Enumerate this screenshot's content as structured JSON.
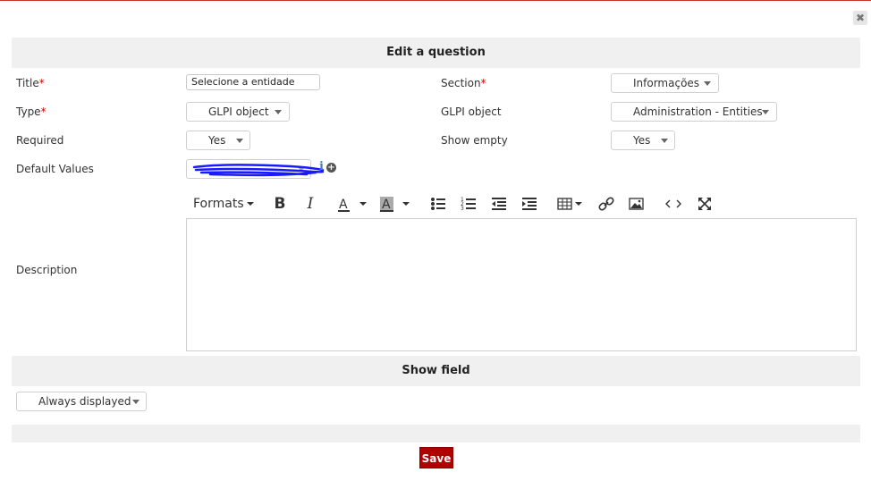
{
  "dialog": {
    "close_icon": "close-icon",
    "close_glyph": "✖"
  },
  "headers": {
    "edit": "Edit a question",
    "show_field": "Show field"
  },
  "form": {
    "title": {
      "label": "Title",
      "required_mark": "*",
      "value": "Selecione a entidade"
    },
    "section": {
      "label": "Section",
      "required_mark": "*",
      "value": "Informações"
    },
    "type": {
      "label": "Type",
      "required_mark": "*",
      "value": "GLPI object"
    },
    "glpi_object": {
      "label": "GLPI object",
      "value": "Administration - Entities"
    },
    "required": {
      "label": "Required",
      "value": "Yes"
    },
    "show_empty": {
      "label": "Show empty",
      "value": "Yes"
    },
    "default_values": {
      "label": "Default Values",
      "info_icon": "info-icon",
      "add_icon": "add-circle-icon"
    },
    "description": {
      "label": "Description"
    }
  },
  "toolbar": {
    "formats": "Formats",
    "icons": [
      "bold-icon",
      "italic-icon",
      "text-color-icon",
      "background-color-icon",
      "bullet-list-icon",
      "numbered-list-icon",
      "outdent-icon",
      "indent-icon",
      "table-icon",
      "link-icon",
      "image-icon",
      "code-icon",
      "fullscreen-icon"
    ]
  },
  "show_field": {
    "value": "Always displayed"
  },
  "actions": {
    "save": "Save"
  },
  "colors": {
    "accent_red": "#b10000",
    "band_bg": "#f0f0f0",
    "scribble_blue": "#1a1aff"
  }
}
